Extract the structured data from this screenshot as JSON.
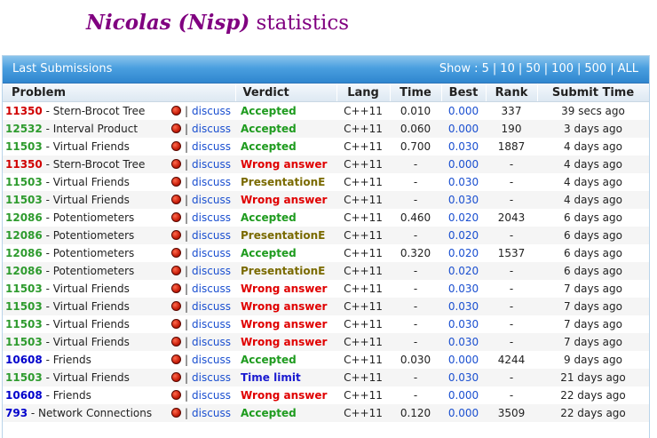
{
  "page": {
    "title_name": "Nicolas (Nisp)",
    "title_suffix": " statistics"
  },
  "panel": {
    "title": "Last Submissions",
    "show_label": "Show :",
    "show_options": [
      "5",
      "10",
      "50",
      "100",
      "500",
      "ALL"
    ]
  },
  "columns": {
    "problem": "Problem",
    "verdict": "Verdict",
    "lang": "Lang",
    "time": "Time",
    "best": "Best",
    "rank": "Rank",
    "submit": "Submit Time"
  },
  "discuss_label": "discuss",
  "bar_sep": "|",
  "id_sep": " - ",
  "colors": {
    "title": "#800080",
    "header_blue": "#2f86cf",
    "accepted": "#1e9b1e",
    "wrong_answer": "#e00000",
    "presentation": "#7a6a00",
    "time_limit": "#1a1ad0",
    "link": "#1a4fd0"
  },
  "rows": [
    {
      "id": "11350",
      "name": "Stern-Brocot Tree",
      "status": "wa",
      "verdict": "Accepted",
      "vclass": "v-ac",
      "lang": "C++11",
      "time": "0.010",
      "best": "0.000",
      "rank": "337",
      "submit": "39 secs ago"
    },
    {
      "id": "12532",
      "name": "Interval Product",
      "status": "ac",
      "verdict": "Accepted",
      "vclass": "v-ac",
      "lang": "C++11",
      "time": "0.060",
      "best": "0.000",
      "rank": "190",
      "submit": "3 days ago"
    },
    {
      "id": "11503",
      "name": "Virtual Friends",
      "status": "ac",
      "verdict": "Accepted",
      "vclass": "v-ac",
      "lang": "C++11",
      "time": "0.700",
      "best": "0.030",
      "rank": "1887",
      "submit": "4 days ago"
    },
    {
      "id": "11350",
      "name": "Stern-Brocot Tree",
      "status": "wa",
      "verdict": "Wrong answer",
      "vclass": "v-wa",
      "lang": "C++11",
      "time": "-",
      "best": "0.000",
      "rank": "-",
      "submit": "4 days ago"
    },
    {
      "id": "11503",
      "name": "Virtual Friends",
      "status": "ac",
      "verdict": "PresentationE",
      "vclass": "v-pe",
      "lang": "C++11",
      "time": "-",
      "best": "0.030",
      "rank": "-",
      "submit": "4 days ago"
    },
    {
      "id": "11503",
      "name": "Virtual Friends",
      "status": "ac",
      "verdict": "Wrong answer",
      "vclass": "v-wa",
      "lang": "C++11",
      "time": "-",
      "best": "0.030",
      "rank": "-",
      "submit": "4 days ago"
    },
    {
      "id": "12086",
      "name": "Potentiometers",
      "status": "ac",
      "verdict": "Accepted",
      "vclass": "v-ac",
      "lang": "C++11",
      "time": "0.460",
      "best": "0.020",
      "rank": "2043",
      "submit": "6 days ago"
    },
    {
      "id": "12086",
      "name": "Potentiometers",
      "status": "ac",
      "verdict": "PresentationE",
      "vclass": "v-pe",
      "lang": "C++11",
      "time": "-",
      "best": "0.020",
      "rank": "-",
      "submit": "6 days ago"
    },
    {
      "id": "12086",
      "name": "Potentiometers",
      "status": "ac",
      "verdict": "Accepted",
      "vclass": "v-ac",
      "lang": "C++11",
      "time": "0.320",
      "best": "0.020",
      "rank": "1537",
      "submit": "6 days ago"
    },
    {
      "id": "12086",
      "name": "Potentiometers",
      "status": "ac",
      "verdict": "PresentationE",
      "vclass": "v-pe",
      "lang": "C++11",
      "time": "-",
      "best": "0.020",
      "rank": "-",
      "submit": "6 days ago"
    },
    {
      "id": "11503",
      "name": "Virtual Friends",
      "status": "ac",
      "verdict": "Wrong answer",
      "vclass": "v-wa",
      "lang": "C++11",
      "time": "-",
      "best": "0.030",
      "rank": "-",
      "submit": "7 days ago"
    },
    {
      "id": "11503",
      "name": "Virtual Friends",
      "status": "ac",
      "verdict": "Wrong answer",
      "vclass": "v-wa",
      "lang": "C++11",
      "time": "-",
      "best": "0.030",
      "rank": "-",
      "submit": "7 days ago"
    },
    {
      "id": "11503",
      "name": "Virtual Friends",
      "status": "ac",
      "verdict": "Wrong answer",
      "vclass": "v-wa",
      "lang": "C++11",
      "time": "-",
      "best": "0.030",
      "rank": "-",
      "submit": "7 days ago"
    },
    {
      "id": "11503",
      "name": "Virtual Friends",
      "status": "ac",
      "verdict": "Wrong answer",
      "vclass": "v-wa",
      "lang": "C++11",
      "time": "-",
      "best": "0.030",
      "rank": "-",
      "submit": "7 days ago"
    },
    {
      "id": "10608",
      "name": "Friends",
      "status": "other",
      "verdict": "Accepted",
      "vclass": "v-ac",
      "lang": "C++11",
      "time": "0.030",
      "best": "0.000",
      "rank": "4244",
      "submit": "9 days ago"
    },
    {
      "id": "11503",
      "name": "Virtual Friends",
      "status": "ac",
      "verdict": "Time limit",
      "vclass": "v-tl",
      "lang": "C++11",
      "time": "-",
      "best": "0.030",
      "rank": "-",
      "submit": "21 days ago"
    },
    {
      "id": "10608",
      "name": "Friends",
      "status": "other",
      "verdict": "Wrong answer",
      "vclass": "v-wa",
      "lang": "C++11",
      "time": "-",
      "best": "0.000",
      "rank": "-",
      "submit": "22 days ago"
    },
    {
      "id": "793",
      "name": "Network Connections",
      "status": "other",
      "verdict": "Accepted",
      "vclass": "v-ac",
      "lang": "C++11",
      "time": "0.120",
      "best": "0.000",
      "rank": "3509",
      "submit": "22 days ago"
    }
  ]
}
